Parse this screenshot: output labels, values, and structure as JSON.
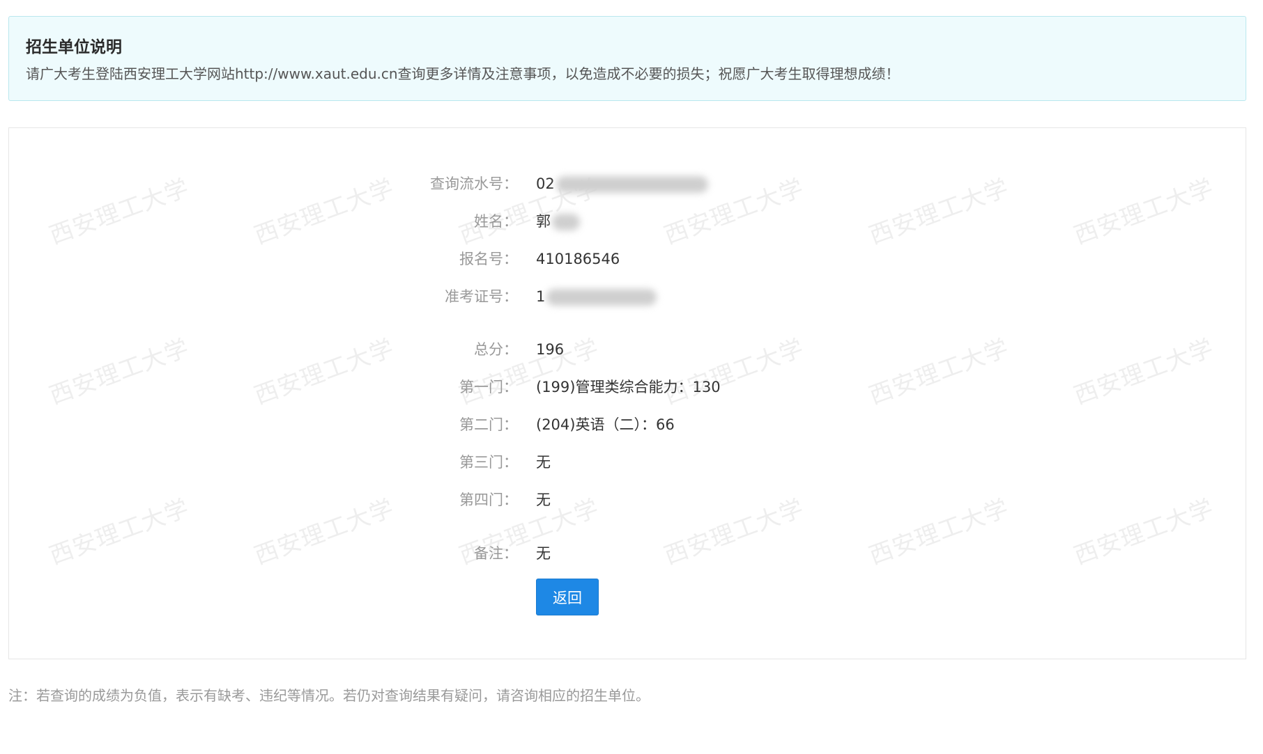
{
  "notice": {
    "title": "招生单位说明",
    "text": "请广大考生登陆西安理工大学网站http://www.xaut.edu.cn查询更多详情及注意事项，以免造成不必要的损失；祝愿广大考生取得理想成绩！"
  },
  "watermark": {
    "text": "西安理工大学"
  },
  "result": {
    "serial": {
      "label": "查询流水号：",
      "value_visible": "02"
    },
    "name": {
      "label": "姓名：",
      "value_visible": "郭"
    },
    "registration": {
      "label": "报名号：",
      "value": "410186546"
    },
    "ticket": {
      "label": "准考证号：",
      "value_visible": "1"
    },
    "total": {
      "label": "总分：",
      "value": "196"
    },
    "subject1": {
      "label": "第一门：",
      "value": "(199)管理类综合能力：130"
    },
    "subject2": {
      "label": "第二门：",
      "value": "(204)英语（二）：66"
    },
    "subject3": {
      "label": "第三门：",
      "value": "无"
    },
    "subject4": {
      "label": "第四门：",
      "value": "无"
    },
    "remark": {
      "label": "备注：",
      "value": "无"
    }
  },
  "actions": {
    "back_label": "返回"
  },
  "footnote": "注：若查询的成绩为负值，表示有缺考、违纪等情况。若仍对查询结果有疑问，请咨询相应的招生单位。"
}
